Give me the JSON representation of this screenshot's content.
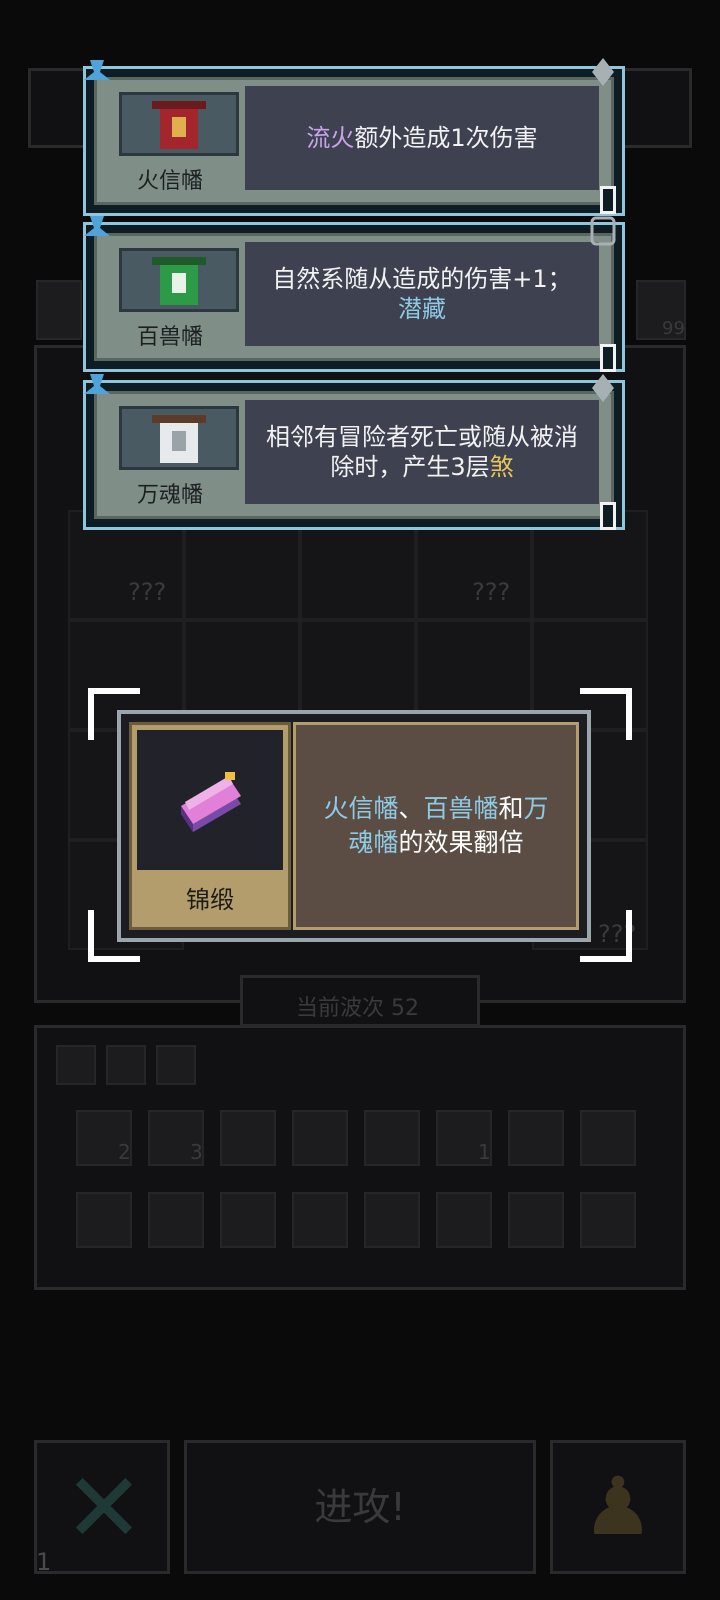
{
  "banners": [
    {
      "name": "火信幡",
      "desc_parts": [
        {
          "text": "流火",
          "color": "purple"
        },
        {
          "text": "额外造成1次伤害",
          "color": "white"
        }
      ],
      "icon": "red-banner-icon"
    },
    {
      "name": "百兽幡",
      "desc_parts": [
        {
          "text": "自然系随从造成的伤害+1；",
          "color": "white"
        },
        {
          "text": "潜藏",
          "color": "blue"
        }
      ],
      "icon": "green-banner-icon"
    },
    {
      "name": "万魂幡",
      "desc_parts": [
        {
          "text": "相邻有冒险者死亡或随从被消除时，产生3层",
          "color": "white"
        },
        {
          "text": "煞",
          "color": "yellow"
        }
      ],
      "icon": "white-banner-icon"
    }
  ],
  "selected_item": {
    "name": "锦缎",
    "icon": "brocade-scroll-icon",
    "desc_parts": [
      {
        "text": "火信幡",
        "color": "blue"
      },
      {
        "text": "、",
        "color": "white"
      },
      {
        "text": "百兽幡",
        "color": "blue"
      },
      {
        "text": "和",
        "color": "white"
      },
      {
        "text": "万魂幡",
        "color": "blue"
      },
      {
        "text": "的效果翻倍",
        "color": "white"
      }
    ]
  },
  "board": {
    "wave_label": "当前波次 52",
    "unknown_value": "???",
    "count_badge": "99",
    "stack_count_1": "2",
    "stack_count_2": "3",
    "stack_count_3": "1"
  },
  "bottom_bar": {
    "attack_label": "进攻!",
    "left_count": "1"
  },
  "colors": {
    "highlight_purple": "#c7a3e8",
    "highlight_blue": "#8fcae3",
    "highlight_yellow": "#e6c65a",
    "card_border": "#8fc6dc"
  }
}
